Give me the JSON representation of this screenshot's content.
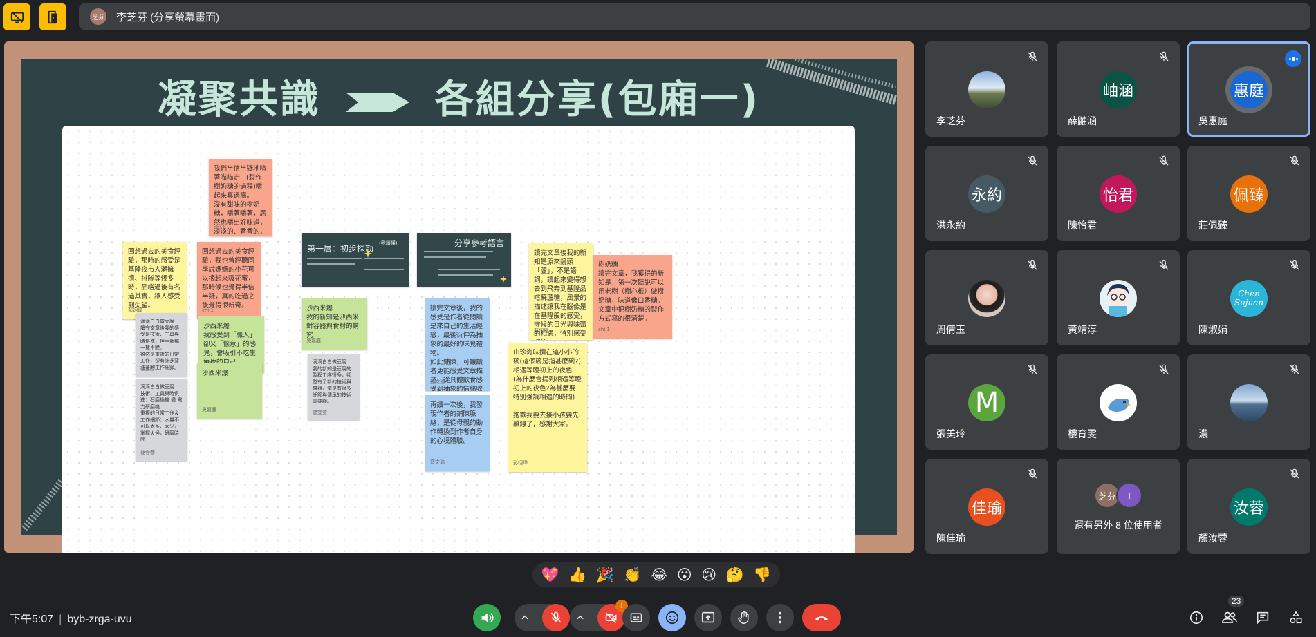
{
  "top_bar": {
    "presenter_initials": "芝芬",
    "presenter_label": "李芝芬 (分享螢幕畫面)"
  },
  "slide": {
    "title_left": "凝聚共識",
    "title_right": "各組分享(包廂一)",
    "notes": [
      {
        "id": "n1",
        "color": "salmon",
        "text": "我們半信半疑地啃著喵喵走...(製作樹奶糖的過程)嚼起來真過癮。\n沒有甜味的樹奶糖，嚼著嚼著，居然也嚼出好味道，淡淡的、香香的，那種味道我說不出來。",
        "author": "chi 1"
      },
      {
        "id": "n2",
        "color": "yellow",
        "text": "回想過去的美食經驗，那時的感受是基隆夜市人潮擁擠、排隊等候多時，品嚐過後有名過其實，讓人感受到失望。",
        "author": "彭翊瑋"
      },
      {
        "id": "n3",
        "color": "salmon",
        "text": "回想過去的美食經驗，我也曾經聽同學說媽媽的小花可以摘起來吸花蜜，那時候也覺得半信半疑，真的吃過之後覺得很新奇。",
        "author": "chi 1"
      },
      {
        "id": "n4",
        "color": "gray",
        "text": "滴滴白白做豆腐\n讀完文章後我的感受是技術、工具與時俱進，但手藝都一樣不變。\n雖然是重複的日常工作，卻有許多要注意的工作細節。",
        "author": "儲宜萱"
      },
      {
        "id": "n5",
        "color": "green",
        "text": "沙西米爆\n我感受到「職人」卻又「懷意」的感覺，會吸引不吃生魚片的自己",
        "author": "吳嘉庭"
      },
      {
        "id": "n6",
        "color": "green",
        "text": "沙西米爆",
        "author": "吳嘉庭"
      },
      {
        "id": "n7",
        "color": "gray",
        "text": "滴滴白白做豆腐\n技術、工具與時俱進：石磨換機 變 電力研磨機\n重複的日常工作＆工作細節：水量不可以太多、太少，掌握火候，研磨時間",
        "author": "儲宜萱"
      },
      {
        "id": "n8",
        "color": "green",
        "text": "沙西米爆\n我的新知是沙西米對容器與食材的講究",
        "author": "吳嘉庭"
      },
      {
        "id": "n9",
        "color": "gray",
        "text": "滴滴白白做豆腐\n我的新知是豆腐的製程工序很多，卻發有了新的技術與機器，還是有很多細節與傳承的技術需要顧。",
        "author": "儲宜萱"
      },
      {
        "id": "n10",
        "color": "blue",
        "text": "讀完文章後，我的感受是作者從閱讀是來自己的生活經驗，最後衍伸為抽象的最好的味覺禮物。\n如此鋪陳，可讓讀者更能感受文章描述，從具體飲食感受到抽象的情緒收穫。",
        "author": "藍文瑜"
      },
      {
        "id": "n11",
        "color": "blue",
        "text": "再讀一次後，我發現作者的鋪陳脈絡，是從母親的動作轉換到作者自身的心境體驗。",
        "author": "藍文瑜"
      },
      {
        "id": "n12",
        "color": "yellow",
        "text": "讀完文章後我的新知是原來鏡頭「蘆」，不是語詞，讀起來變得想去到飛奔到基隆品嚐蘇蘆糖，風景的描述讓我在腦像是在基隆般的感受，守候的目光與味蕾的相遇，特別感受期待。",
        "author": "彭翊瑋"
      },
      {
        "id": "n13",
        "color": "yellow",
        "text": "山珍海味擠在這小小的碗(這個碗是指甚麼碗?)\n相遇等瞪初上的夜色\n(為什麼會提到相遇等瞪初上的夜色?為甚麼要特別強調相遇的時間)\n\n抱歉我要去接小孩要先離線了，感謝大家。",
        "author": "彭翊瑋"
      },
      {
        "id": "n14",
        "color": "salmon",
        "text": "樹奶糖\n讀完文章，我獲得的新知是：第一次聽說可以用老樹（樹心柢）做樹奶糖，味道像口香糖。\n文章中把樹奶糖的製作方式寫的很清楚。",
        "author": "chi 1"
      }
    ],
    "mini_slides": [
      {
        "id": "s1",
        "title": "第一層：初步探勘",
        "subtitle": "(我讀懂)"
      },
      {
        "id": "s2",
        "title": "分享參考語言",
        "subtitle": ""
      }
    ]
  },
  "participants": [
    {
      "name": "李芝芬",
      "initials": "",
      "avatar_type": "photo-mountain",
      "bg": "#6b8fb3",
      "muted": true
    },
    {
      "name": "薛鼬涵",
      "initials": "岫涵",
      "avatar_type": "initials",
      "bg": "#0b5345",
      "muted": true
    },
    {
      "name": "吳惠庭",
      "initials": "惠庭",
      "avatar_type": "initials",
      "bg": "#1967d2",
      "muted": false,
      "speaking": true
    },
    {
      "name": "洪永約",
      "initials": "永約",
      "avatar_type": "initials",
      "bg": "#455a64",
      "muted": true
    },
    {
      "name": "陳怡君",
      "initials": "怡君",
      "avatar_type": "initials",
      "bg": "#c2185b",
      "muted": true
    },
    {
      "name": "莊佩臻",
      "initials": "佩臻",
      "avatar_type": "initials",
      "bg": "#e8710a",
      "muted": true
    },
    {
      "name": "周倩玉",
      "initials": "",
      "avatar_type": "photo-person",
      "bg": "#d9c6c0",
      "muted": true
    },
    {
      "name": "黃靖淳",
      "initials": "",
      "avatar_type": "photo-anime",
      "bg": "#e6f2f8",
      "muted": true
    },
    {
      "name": "陳淑娟",
      "initials": "Chen Sujuan",
      "avatar_type": "logo",
      "bg": "#2bb5d9",
      "muted": true
    },
    {
      "name": "張美玲",
      "initials": "M",
      "avatar_type": "initials",
      "bg": "#5aa63c",
      "muted": true
    },
    {
      "name": "樓育雯",
      "initials": "",
      "avatar_type": "photo-bird",
      "bg": "#ffffff",
      "muted": true
    },
    {
      "name": "濃",
      "initials": "",
      "avatar_type": "photo-sky",
      "bg": "#5f88b0",
      "muted": true
    },
    {
      "name": "陳佳瑜",
      "initials": "佳瑜",
      "avatar_type": "initials",
      "bg": "#e8501f",
      "muted": true
    }
  ],
  "more_tile": {
    "avatar1": "芝芬",
    "avatar2": "I",
    "label": "還有另外 8 位使用者"
  },
  "last_tile": {
    "name": "顏汝蓉",
    "initials": "汝蓉",
    "bg": "#00796b",
    "muted": true
  },
  "reactions": [
    "💖",
    "👍",
    "🎉",
    "👏",
    "😂",
    "😮",
    "😢",
    "🤔",
    "👎"
  ],
  "bottom": {
    "time": "下午5:07",
    "meeting_code": "byb-zrga-uvu",
    "people_count": "23",
    "camera_alert": "!"
  },
  "colors": {
    "accent": "#8ab4f8",
    "hangup": "#ea4335",
    "mic_off": "#ea4335",
    "audio_on": "#34a853",
    "emoji_active": "#8ab4f8"
  }
}
